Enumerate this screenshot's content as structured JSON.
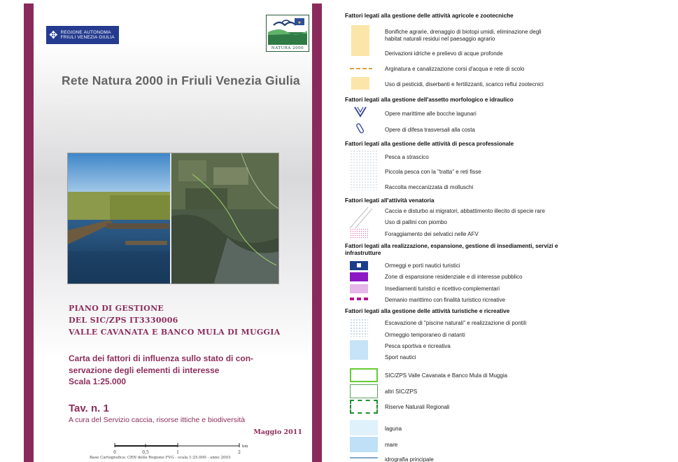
{
  "cover": {
    "region_logo_text": "REGIONE AUTONOMA FRIULI VENEZIA GIULIA",
    "natura_logo_text": "NATURA 2000",
    "title": "Rete Natura 2000 in Friuli Venezia Giulia",
    "plan_line1": "PIANO DI GESTIONE",
    "plan_line2": "DEL SIC/ZPS IT3330006",
    "plan_line3": "VALLE CAVANATA E  BANCO MULA DI MUGGIA",
    "map_title": "Carta dei fattori di influenza sullo stato di con-servazione degli elementi di interesse",
    "map_scale": "Scala 1:25.000",
    "tav": "Tav. n. 1",
    "curated_by": "A cura del Servizio caccia, risorse ittiche e biodiversità",
    "date": "Maggio 2011",
    "scalebar": {
      "ticks": [
        "0",
        "0,5",
        "1",
        "2"
      ],
      "unit": "km"
    },
    "basemap_note": "Base Cartografica: CRN della Regione FVG - scala 1:25.000 - anno 2003"
  },
  "legend": {
    "sections": [
      {
        "title": "Fattori legati alla gestione delle attività agricole e zootecniche",
        "items": [
          "Bonifiche agrarie, drenaggio di biotopi umidi, eliminazione degli",
          "habitat naturali residui nel paesaggio agrario",
          "Derivazioni idriche e prelievo di acque profonde",
          "Arginatura e canalizzazione corsi d'acqua e rete di scolo",
          "Uso di pesticidi, diserbanti e fertilizzanti, scarico reflui zootecnici"
        ]
      },
      {
        "title": "Fattori legati alla gestione dell'assetto morfologico e idraulico",
        "items": [
          "Opere marittime alle bocche lagunari",
          "Opere di difesa trasversali alla costa"
        ]
      },
      {
        "title": "Fattori legati alla gestione delle attività di pesca professionale",
        "items": [
          "Pesca a strascico",
          "Piccola pesca con la \"tratta\" e reti fisse",
          "Raccolta meccanizzata di molluschi"
        ]
      },
      {
        "title": "Fattori legati all'attività venatoria",
        "items": [
          "Caccia e disturbo ai migratori, abbattimento illecito di specie rare",
          "Uso di pallini con piombo",
          "Foraggiamento dei selvatici nelle AFV"
        ]
      },
      {
        "title": "Fattori legati alla realizzazione, espansione, gestione di insediamenti, servizi e",
        "title2": "infrastrutture",
        "items": [
          "Ormeggi e porti nautici turistici",
          "Zone di espansione residenziale e di interesse pubblico",
          "Insediamenti turistici e ricettivo-complementari",
          "Demanio marittimo con finalità turistico ricreative"
        ]
      },
      {
        "title": "Fattori legati alla gestione delle attività turistiche e ricreative",
        "items": [
          "Escavazione di \"piscine naturali\" e realizzazione di pontili",
          "Ormeggio temporaneo di natanti",
          "Pesca sportiva e ricreativa",
          "Sport nautici"
        ]
      }
    ],
    "boundaries": [
      "SIC/ZPS Valle Cavanata e Banco Mula di Muggia",
      "altri SIC/ZPS",
      "Riserve Naturali Regionali"
    ],
    "base": [
      "laguna",
      "mare",
      "idrografia principale"
    ],
    "colors": {
      "agri_fill": "#fbe5a9",
      "dyke_line": "#d8a23c",
      "structure_blue": "#3a4f9c",
      "port_fill": "#1d3d8a",
      "residential": "#8b18c4",
      "tourist_settlement": "#e6b5ea",
      "demanio": "#b7148f",
      "recreation_fill": "#c6e3f7",
      "sic_main": "#66cc33",
      "sic_other": "#5fa25f",
      "reserve": "#1f8f2f",
      "laguna": "#dff1fb",
      "mare": "#bfe0f6",
      "river": "#7fa8c9",
      "cover_band": "#8a2a5c"
    }
  }
}
